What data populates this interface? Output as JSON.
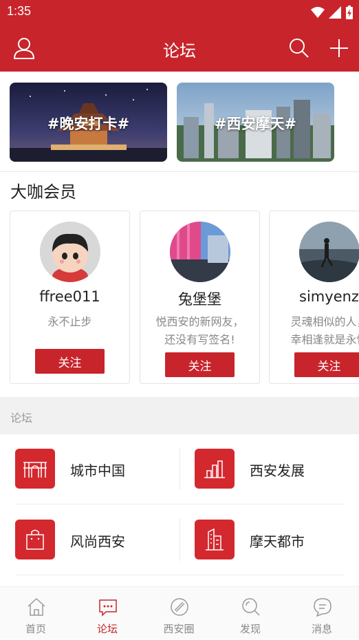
{
  "status_bar": {
    "time": "1:35"
  },
  "header": {
    "title": "论坛",
    "profile_icon": "person-icon",
    "search_icon": "search-icon",
    "add_icon": "plus-icon",
    "bg_color": "#c8242b"
  },
  "banners": [
    {
      "label": "#晚安打卡#"
    },
    {
      "label": "#西安摩天#"
    }
  ],
  "members_section": {
    "title": "大咖会员",
    "members": [
      {
        "name": "ffree011",
        "bio": "永不止步",
        "follow_label": "关注"
      },
      {
        "name": "兔堡堡",
        "bio": "悦西安的新网友，\n还没有写签名!",
        "follow_label": "关注"
      },
      {
        "name": "simyenz",
        "bio": "灵魂相似的人，\n幸相逢就是永恒",
        "follow_label": "关注"
      }
    ]
  },
  "forum_section": {
    "title": "论坛",
    "items": [
      {
        "name": "城市中国",
        "icon": "city-gate-icon"
      },
      {
        "name": "西安发展",
        "icon": "bar-chart-icon"
      },
      {
        "name": "风尚西安",
        "icon": "shopping-bag-icon"
      },
      {
        "name": "摩天都市",
        "icon": "skyscraper-icon"
      }
    ]
  },
  "tabs": [
    {
      "label": "首页",
      "icon": "home-icon",
      "active": false
    },
    {
      "label": "论坛",
      "icon": "chat-icon",
      "active": true
    },
    {
      "label": "西安圈",
      "icon": "circle-icon",
      "active": false
    },
    {
      "label": "发现",
      "icon": "discover-icon",
      "active": false
    },
    {
      "label": "消息",
      "icon": "message-icon",
      "active": false
    }
  ],
  "colors": {
    "accent": "#c8242b",
    "icon_tile": "#d4282f",
    "inactive": "#888888"
  }
}
